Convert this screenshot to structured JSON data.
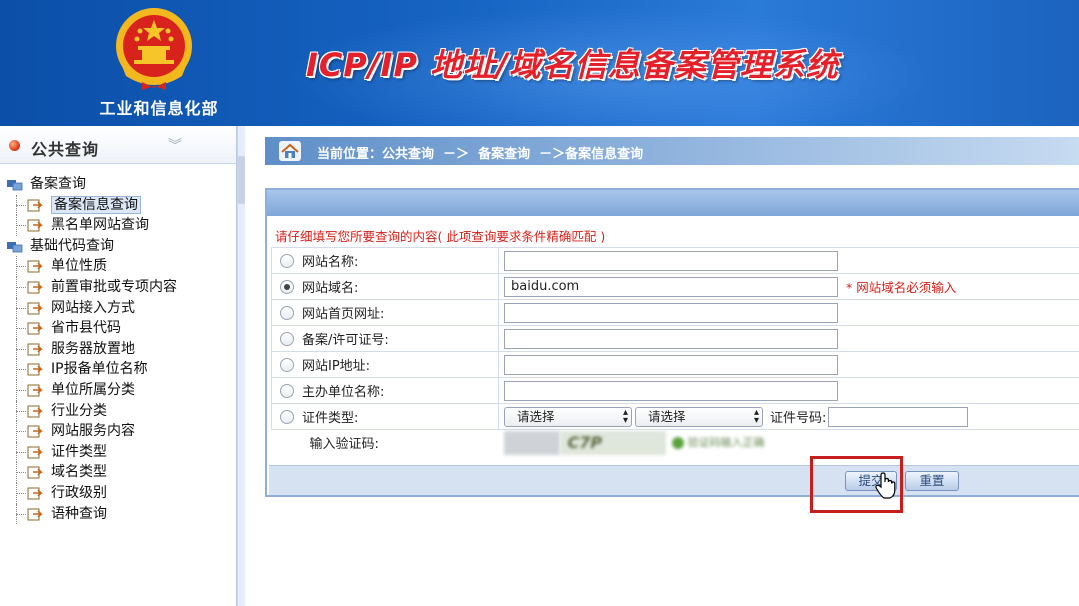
{
  "header": {
    "ministry": "工业和信息化部",
    "system_title": "ICP/IP 地址/域名信息备案管理系统"
  },
  "sidebar": {
    "title": "公共查询",
    "groups": [
      {
        "label": "备案查询",
        "items": [
          "备案信息查询",
          "黑名单网站查询"
        ],
        "selected": "备案信息查询"
      },
      {
        "label": "基础代码查询",
        "items": [
          "单位性质",
          "前置审批或专项内容",
          "网站接入方式",
          "省市县代码",
          "服务器放置地",
          "IP报备单位名称",
          "单位所属分类",
          "行业分类",
          "网站服务内容",
          "证件类型",
          "域名类型",
          "行政级别",
          "语种查询"
        ]
      }
    ]
  },
  "breadcrumb": "当前位置：公共查询  －＞  备案查询  －＞备案信息查询",
  "form": {
    "instruction": "请仔细填写您所要查询的内容( 此项查询要求条件精确匹配 )",
    "fields": [
      {
        "label": "网站名称:",
        "value": "",
        "selected": false
      },
      {
        "label": "网站域名:",
        "value": "baidu.com",
        "selected": true,
        "required_note": "* 网站域名必须输入"
      },
      {
        "label": "网站首页网址:",
        "value": "",
        "selected": false
      },
      {
        "label": "备案/许可证号:",
        "value": "",
        "selected": false
      },
      {
        "label": "网站IP地址:",
        "value": "",
        "selected": false
      },
      {
        "label": "主办单位名称:",
        "value": "",
        "selected": false
      }
    ],
    "id_type": {
      "label": "证件类型:",
      "select1": "请选择",
      "select2": "请选择",
      "id_number_label": "证件号码:"
    },
    "captcha": {
      "label": "输入验证码:",
      "image_text": "C7P",
      "hint": "验证码输入正确"
    },
    "buttons": {
      "submit": "提交",
      "reset": "重置"
    }
  }
}
